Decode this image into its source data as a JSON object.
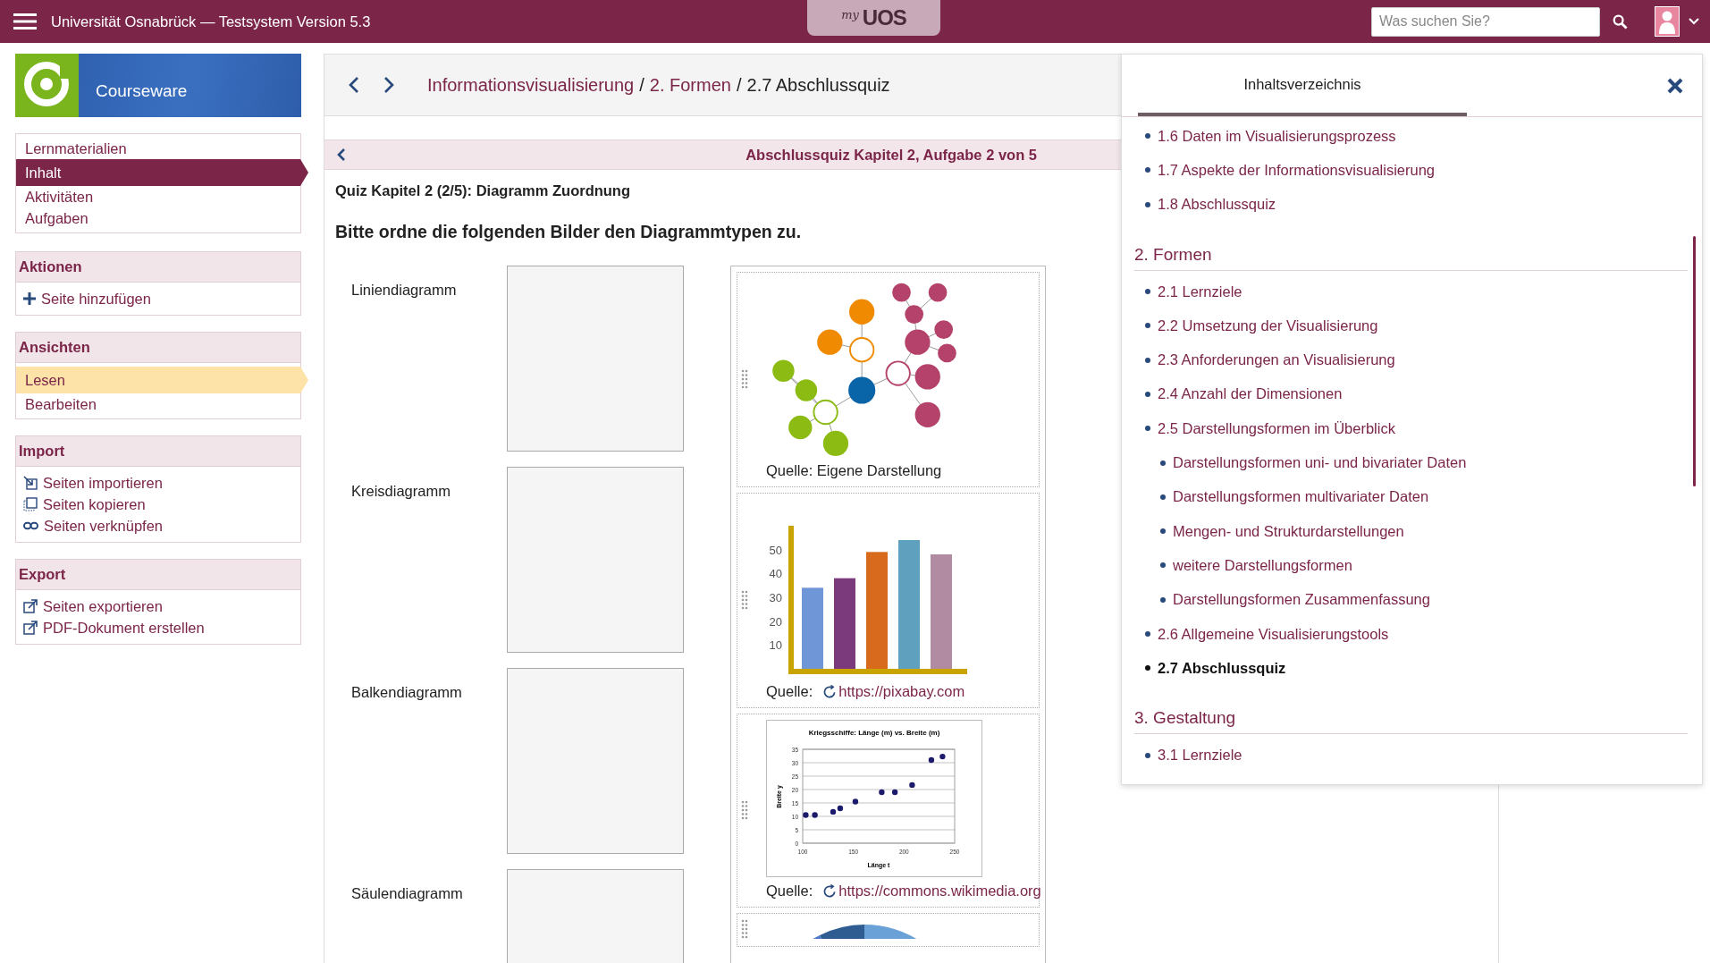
{
  "top_bar": {
    "title": "Universität Osnabrück — Testsystem Version 5.3",
    "logo_prefix": "my",
    "logo_text": "UOS",
    "search": {
      "placeholder": "Was suchen Sie?"
    }
  },
  "sidebar": {
    "header": {
      "title": "Courseware"
    },
    "groups": [
      {
        "kind": "navigation",
        "items": [
          {
            "label": "Lernmaterialien",
            "selected": false
          },
          {
            "label": "Inhalt",
            "selected": true
          },
          {
            "label": "Aktivitäten",
            "selected": false
          },
          {
            "label": "Aufgaben",
            "selected": false
          }
        ]
      },
      {
        "kind": "actions",
        "title": "Aktionen",
        "items": [
          {
            "label": "Seite hinzufügen",
            "kind": "add"
          }
        ]
      },
      {
        "kind": "views",
        "title": "Ansichten",
        "items": [
          {
            "label": "Lesen",
            "selected": true
          },
          {
            "label": "Bearbeiten",
            "selected": false
          }
        ]
      },
      {
        "kind": "actions",
        "title": "Import",
        "items": [
          {
            "label": "Seiten importieren",
            "kind": "import"
          },
          {
            "label": "Seiten kopieren",
            "kind": "copy"
          },
          {
            "label": "Seiten verknüpfen",
            "kind": "link"
          }
        ]
      },
      {
        "kind": "actions",
        "title": "Export",
        "items": [
          {
            "label": "Seiten exportieren",
            "kind": "export"
          },
          {
            "label": "PDF-Dokument erstellen",
            "kind": "export"
          }
        ]
      }
    ]
  },
  "breadcrumb": {
    "separator": "/",
    "items": [
      {
        "label": "Informationsvisualisierung",
        "current": false
      },
      {
        "label": "2. Formen",
        "current": false
      },
      {
        "label": "2.7 Abschlussquiz",
        "current": true
      }
    ]
  },
  "quiz": {
    "header": "Abschlussquiz Kapitel 2, Aufgabe 2 von 5",
    "title": "Quiz Kapitel 2 (2/5): Diagramm Zuordnung",
    "instruction": "Bitte ordne die folgenden Bilder den Diagrammtypen zu.",
    "categories": [
      {
        "label": "Liniendiagramm"
      },
      {
        "label": "Kreisdiagramm"
      },
      {
        "label": "Balkendiagramm"
      },
      {
        "label": "Säulendiagramm"
      }
    ],
    "images": [
      {
        "kind": "mindmap",
        "source": "Quelle: Eigene Darstellung"
      },
      {
        "source": "Quelle:",
        "source_link": "https://pixabay.com",
        "chart_data": {
          "type": "bar",
          "values": [
            34,
            38,
            49,
            54,
            48
          ],
          "yticks": [
            10,
            20,
            30,
            40,
            50
          ],
          "ylim": [
            0,
            60
          ]
        }
      },
      {
        "source": "Quelle:",
        "source_link": "https://commons.wikimedia.org",
        "chart_data": {
          "type": "scatter",
          "title": "Kriegsschiffe: Länge (m) vs. Breite (m)",
          "xlabel": "Länge t",
          "ylabel": "Breite y",
          "xlim": [
            100,
            250
          ],
          "ylim": [
            0,
            35
          ],
          "xticks": [
            100,
            150,
            200,
            250
          ],
          "yticks": [
            0,
            5,
            10,
            15,
            20,
            25,
            30,
            35
          ],
          "grid": true,
          "x": [
            103,
            112,
            130,
            137,
            152,
            178,
            191,
            208,
            227,
            238
          ],
          "values": [
            10.5,
            10.5,
            11.7,
            13,
            15.5,
            19,
            19,
            21.7,
            31,
            32.3
          ]
        }
      },
      {
        "kind": "pie"
      }
    ]
  },
  "toc": {
    "tabs": [
      {
        "label": "Inhaltsverzeichnis",
        "selected": true
      }
    ],
    "sections": [
      {
        "items": [
          {
            "label": "1.6 Daten im Visualisierungsprozess",
            "selected": false
          },
          {
            "label": "1.7 Aspekte der Informationsvisualisierung",
            "selected": false
          },
          {
            "label": "1.8 Abschlussquiz",
            "selected": false
          }
        ]
      },
      {
        "heading": "2. Formen",
        "items": [
          {
            "label": "2.1 Lernziele",
            "selected": false
          },
          {
            "label": "2.2 Umsetzung der Visualisierung",
            "selected": false
          },
          {
            "label": "2.3 Anforderungen an Visualisierung",
            "selected": false
          },
          {
            "label": "2.4 Anzahl der Dimensionen",
            "selected": false
          },
          {
            "label": "2.5 Darstellungsformen im Überblick",
            "selected": false,
            "children": [
              {
                "label": "Darstellungsformen uni- und bivariater Daten",
                "selected": false
              },
              {
                "label": "Darstellungsformen multivariater Daten",
                "selected": false
              },
              {
                "label": "Mengen- und Strukturdarstellungen",
                "selected": false
              },
              {
                "label": "weitere Darstellungsformen",
                "selected": false
              },
              {
                "label": "Darstellungsformen Zusammenfassung",
                "selected": false
              }
            ]
          },
          {
            "label": "2.6 Allgemeine Visualisierungstools",
            "selected": false
          },
          {
            "label": "2.7 Abschlussquiz",
            "selected": true
          }
        ]
      },
      {
        "heading": "3. Gestaltung",
        "items": [
          {
            "label": "3.1 Lernziele",
            "selected": false
          }
        ]
      }
    ]
  }
}
